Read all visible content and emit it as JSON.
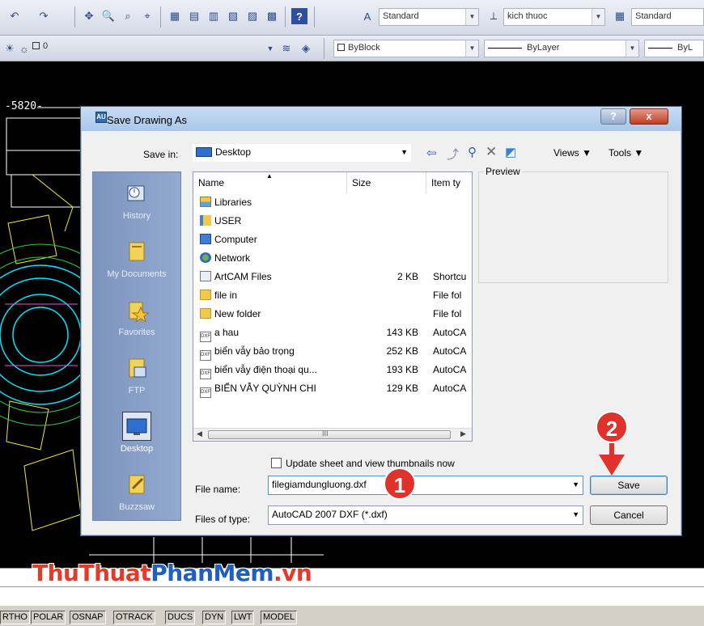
{
  "toolbar1": {
    "icons": [
      "undo-icon",
      "redo-icon",
      "pan-icon",
      "zoom-realtime-icon",
      "zoom-window-icon",
      "zoom-previous-icon",
      "properties-icon",
      "design-center-icon",
      "tool-palettes-icon",
      "sheet-set-icon",
      "markup-icon",
      "calculator-icon",
      "help-icon"
    ],
    "text_style_value": "Standard",
    "dim_style_value": "kich thuoc",
    "table_style_value": "Standard"
  },
  "toolbar2": {
    "layer_value": "0",
    "color_value": "ByBlock",
    "linetype_value": "ByLayer",
    "lineweight_value": "ByL"
  },
  "canvas": {
    "dimension_text": "-5820-"
  },
  "dialog": {
    "title": "Save Drawing As",
    "title_icon": "AU",
    "help_label": "?",
    "close_label": "x",
    "save_in_label": "Save in:",
    "save_in_value": "Desktop",
    "toolbar_icons": [
      "back-icon",
      "up-folder-icon",
      "search-web-icon",
      "delete-icon",
      "new-folder-icon"
    ],
    "views_label": "Views",
    "tools_label": "Tools",
    "preview_label": "Preview",
    "places": [
      {
        "label": "History",
        "icon": "history-icon"
      },
      {
        "label": "My Documents",
        "icon": "my-documents-icon"
      },
      {
        "label": "Favorites",
        "icon": "favorites-icon"
      },
      {
        "label": "FTP",
        "icon": "ftp-icon"
      },
      {
        "label": "Desktop",
        "icon": "desktop-icon"
      },
      {
        "label": "Buzzsaw",
        "icon": "buzzsaw-icon"
      }
    ],
    "columns": {
      "name": "Name",
      "size": "Size",
      "type": "Item ty"
    },
    "files": [
      {
        "name": "Libraries",
        "size": "",
        "type": "",
        "icon": "libraries-icon"
      },
      {
        "name": "USER",
        "size": "",
        "type": "",
        "icon": "user-folder-icon"
      },
      {
        "name": "Computer",
        "size": "",
        "type": "",
        "icon": "computer-icon"
      },
      {
        "name": "Network",
        "size": "",
        "type": "",
        "icon": "network-icon"
      },
      {
        "name": "ArtCAM Files",
        "size": "2 KB",
        "type": "Shortcu",
        "icon": "shortcut-icon"
      },
      {
        "name": "file in",
        "size": "",
        "type": "File fol",
        "icon": "folder-icon"
      },
      {
        "name": "New folder",
        "size": "",
        "type": "File fol",
        "icon": "folder-icon"
      },
      {
        "name": "a hau",
        "size": "143 KB",
        "type": "AutoCA",
        "icon": "dwg-file-icon"
      },
      {
        "name": "biển vẫy bảo trọng",
        "size": "252 KB",
        "type": "AutoCA",
        "icon": "dwg-file-icon"
      },
      {
        "name": "biển vẫy điện thoại qu...",
        "size": "193 KB",
        "type": "AutoCA",
        "icon": "dwg-file-icon"
      },
      {
        "name": "BIỂN VẪY QUỲNH CHI",
        "size": "129 KB",
        "type": "AutoCA",
        "icon": "dwg-file-icon"
      }
    ],
    "update_thumbnails_label": "Update sheet and view thumbnails now",
    "file_name_label": "File name:",
    "file_name_value": "filegiamdungluong.dxf",
    "files_of_type_label": "Files of type:",
    "files_of_type_value": "AutoCAD 2007 DXF (*.dxf)",
    "save_label": "Save",
    "cancel_label": "Cancel",
    "file_icon_text": "DXF",
    "scroll_thumb_grip": "III"
  },
  "callouts": {
    "step1": "1",
    "step2": "2"
  },
  "watermark": {
    "part1": "ThuThuat",
    "part2": "PhanMem",
    "part3": ".vn"
  },
  "statusbar": {
    "buttons": [
      "RTHO",
      "POLAR",
      "OSNAP",
      "OTRACK",
      "DUCS",
      "DYN",
      "LWT",
      "MODEL"
    ]
  },
  "colors": {
    "callout": "#e0312a",
    "places_bar": "#8aa0c8",
    "accent_blue": "#1f5fbf",
    "drawing_cyan": "#00e5ff",
    "drawing_yellow": "#f5e633"
  }
}
